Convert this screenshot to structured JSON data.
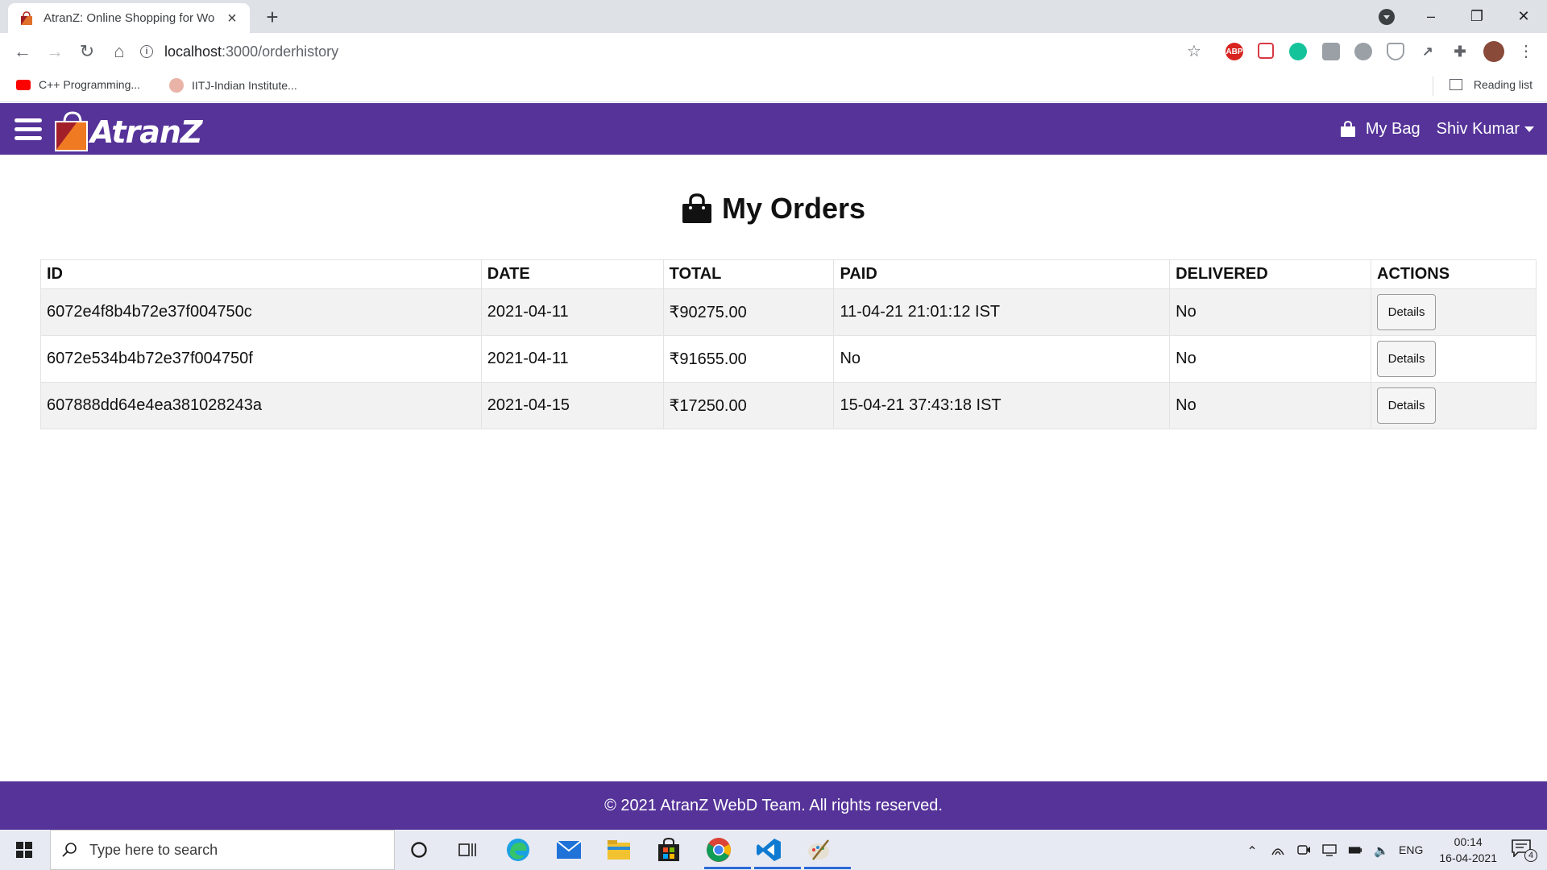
{
  "browser": {
    "tab_title": "AtranZ: Online Shopping for Wo",
    "url_host": "localhost",
    "url_path": ":3000/orderhistory",
    "bookmarks": [
      {
        "label": "C++ Programming..."
      },
      {
        "label": "IITJ-Indian Institute..."
      }
    ],
    "reading_list_label": "Reading list",
    "extension_abp_label": "ABP"
  },
  "site": {
    "brand": "AtranZ",
    "bag_label": "My Bag",
    "user_name": "Shiv Kumar",
    "page_title": "My Orders",
    "primary_color": "#553399"
  },
  "orders": {
    "columns": [
      "ID",
      "DATE",
      "TOTAL",
      "PAID",
      "DELIVERED",
      "ACTIONS"
    ],
    "rows": [
      {
        "id": "6072e4f8b4b72e37f004750c",
        "date": "2021-04-11",
        "total": "₹90275.00",
        "paid": "11-04-21 21:01:12 IST",
        "delivered": "No",
        "action": "Details"
      },
      {
        "id": "6072e534b4b72e37f004750f",
        "date": "2021-04-11",
        "total": "₹91655.00",
        "paid": "No",
        "delivered": "No",
        "action": "Details"
      },
      {
        "id": "607888dd64e4ea381028243a",
        "date": "2021-04-15",
        "total": "₹17250.00",
        "paid": "15-04-21 37:43:18 IST",
        "delivered": "No",
        "action": "Details"
      }
    ]
  },
  "footer": {
    "text": "© 2021 AtranZ WebD Team. All rights reserved."
  },
  "taskbar": {
    "search_placeholder": "Type here to search",
    "language": "ENG",
    "time": "00:14",
    "date": "16-04-2021",
    "notification_count": "4"
  }
}
